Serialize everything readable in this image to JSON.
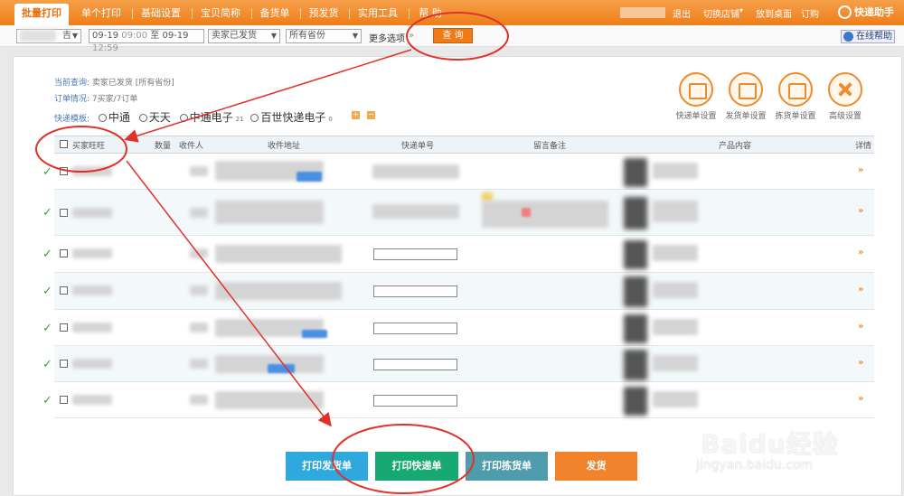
{
  "nav": {
    "tabs": [
      "批量打印",
      "单个打印",
      "基础设置",
      "宝贝简称",
      "备货单",
      "预发货",
      "实用工具",
      "帮 助"
    ],
    "right_links": [
      "退出",
      "切换店铺",
      "放到桌面",
      "订购"
    ],
    "brand": "快递助手"
  },
  "filter": {
    "shop_select": "吉",
    "date_from": "09-19",
    "time_from": "09:00",
    "to_label": "至",
    "date_to": "09-19",
    "time_to": "12:59",
    "status_select": "卖家已发货",
    "province_select": "所有省份",
    "more_label": "更多选项",
    "query_label": "查 询",
    "help_label": "在线帮助"
  },
  "info": {
    "current_query_label": "当前查询:",
    "current_query_value": "卖家已发货 [所有省份]",
    "order_status_label": "订单情况:",
    "order_status_value": "7买家/7订单",
    "template_label": "快递模板:",
    "templates": [
      {
        "name": "中通",
        "count": ""
      },
      {
        "name": "天天",
        "count": ""
      },
      {
        "name": "中通电子",
        "count": "21"
      },
      {
        "name": "百世快递电子",
        "count": "0"
      }
    ],
    "plus": "+",
    "minus": "−"
  },
  "settings": [
    {
      "label": "快递单设置",
      "icon": "waybill-settings-icon"
    },
    {
      "label": "发货单设置",
      "icon": "invoice-settings-icon"
    },
    {
      "label": "拣货单设置",
      "icon": "picklist-settings-icon"
    },
    {
      "label": "高级设置",
      "icon": "tools-icon"
    }
  ],
  "table": {
    "headers": [
      "买家旺旺",
      "数量",
      "收件人",
      "收件地址",
      "快递单号",
      "留言备注",
      "产品内容",
      "详情"
    ],
    "row_count": 7
  },
  "actions": {
    "print_invoice": "打印发货单",
    "print_waybill": "打印快递单",
    "print_picklist": "打印拣货单",
    "ship": "发货"
  },
  "colors": {
    "nav": "#ee7d19",
    "print_invoice": "#2fa8dd",
    "print_waybill": "#17a974",
    "print_picklist": "#4f9cac",
    "ship": "#f0832c",
    "annotation": "#e0322a"
  },
  "watermark": {
    "text": "Baidu经验",
    "sub": "jingyan.baidu.com"
  }
}
